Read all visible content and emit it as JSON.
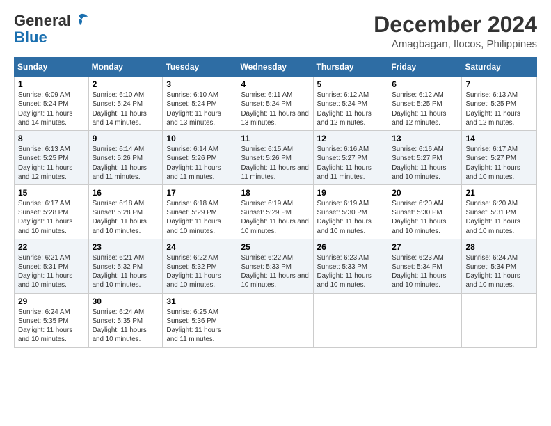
{
  "logo": {
    "general": "General",
    "blue": "Blue"
  },
  "title": {
    "month_year": "December 2024",
    "location": "Amagbagan, Ilocos, Philippines"
  },
  "days_of_week": [
    "Sunday",
    "Monday",
    "Tuesday",
    "Wednesday",
    "Thursday",
    "Friday",
    "Saturday"
  ],
  "weeks": [
    [
      {
        "day": "1",
        "info": "Sunrise: 6:09 AM\nSunset: 5:24 PM\nDaylight: 11 hours and 14 minutes."
      },
      {
        "day": "2",
        "info": "Sunrise: 6:10 AM\nSunset: 5:24 PM\nDaylight: 11 hours and 14 minutes."
      },
      {
        "day": "3",
        "info": "Sunrise: 6:10 AM\nSunset: 5:24 PM\nDaylight: 11 hours and 13 minutes."
      },
      {
        "day": "4",
        "info": "Sunrise: 6:11 AM\nSunset: 5:24 PM\nDaylight: 11 hours and 13 minutes."
      },
      {
        "day": "5",
        "info": "Sunrise: 6:12 AM\nSunset: 5:24 PM\nDaylight: 11 hours and 12 minutes."
      },
      {
        "day": "6",
        "info": "Sunrise: 6:12 AM\nSunset: 5:25 PM\nDaylight: 11 hours and 12 minutes."
      },
      {
        "day": "7",
        "info": "Sunrise: 6:13 AM\nSunset: 5:25 PM\nDaylight: 11 hours and 12 minutes."
      }
    ],
    [
      {
        "day": "8",
        "info": "Sunrise: 6:13 AM\nSunset: 5:25 PM\nDaylight: 11 hours and 12 minutes."
      },
      {
        "day": "9",
        "info": "Sunrise: 6:14 AM\nSunset: 5:26 PM\nDaylight: 11 hours and 11 minutes."
      },
      {
        "day": "10",
        "info": "Sunrise: 6:14 AM\nSunset: 5:26 PM\nDaylight: 11 hours and 11 minutes."
      },
      {
        "day": "11",
        "info": "Sunrise: 6:15 AM\nSunset: 5:26 PM\nDaylight: 11 hours and 11 minutes."
      },
      {
        "day": "12",
        "info": "Sunrise: 6:16 AM\nSunset: 5:27 PM\nDaylight: 11 hours and 11 minutes."
      },
      {
        "day": "13",
        "info": "Sunrise: 6:16 AM\nSunset: 5:27 PM\nDaylight: 11 hours and 10 minutes."
      },
      {
        "day": "14",
        "info": "Sunrise: 6:17 AM\nSunset: 5:27 PM\nDaylight: 11 hours and 10 minutes."
      }
    ],
    [
      {
        "day": "15",
        "info": "Sunrise: 6:17 AM\nSunset: 5:28 PM\nDaylight: 11 hours and 10 minutes."
      },
      {
        "day": "16",
        "info": "Sunrise: 6:18 AM\nSunset: 5:28 PM\nDaylight: 11 hours and 10 minutes."
      },
      {
        "day": "17",
        "info": "Sunrise: 6:18 AM\nSunset: 5:29 PM\nDaylight: 11 hours and 10 minutes."
      },
      {
        "day": "18",
        "info": "Sunrise: 6:19 AM\nSunset: 5:29 PM\nDaylight: 11 hours and 10 minutes."
      },
      {
        "day": "19",
        "info": "Sunrise: 6:19 AM\nSunset: 5:30 PM\nDaylight: 11 hours and 10 minutes."
      },
      {
        "day": "20",
        "info": "Sunrise: 6:20 AM\nSunset: 5:30 PM\nDaylight: 11 hours and 10 minutes."
      },
      {
        "day": "21",
        "info": "Sunrise: 6:20 AM\nSunset: 5:31 PM\nDaylight: 11 hours and 10 minutes."
      }
    ],
    [
      {
        "day": "22",
        "info": "Sunrise: 6:21 AM\nSunset: 5:31 PM\nDaylight: 11 hours and 10 minutes."
      },
      {
        "day": "23",
        "info": "Sunrise: 6:21 AM\nSunset: 5:32 PM\nDaylight: 11 hours and 10 minutes."
      },
      {
        "day": "24",
        "info": "Sunrise: 6:22 AM\nSunset: 5:32 PM\nDaylight: 11 hours and 10 minutes."
      },
      {
        "day": "25",
        "info": "Sunrise: 6:22 AM\nSunset: 5:33 PM\nDaylight: 11 hours and 10 minutes."
      },
      {
        "day": "26",
        "info": "Sunrise: 6:23 AM\nSunset: 5:33 PM\nDaylight: 11 hours and 10 minutes."
      },
      {
        "day": "27",
        "info": "Sunrise: 6:23 AM\nSunset: 5:34 PM\nDaylight: 11 hours and 10 minutes."
      },
      {
        "day": "28",
        "info": "Sunrise: 6:24 AM\nSunset: 5:34 PM\nDaylight: 11 hours and 10 minutes."
      }
    ],
    [
      {
        "day": "29",
        "info": "Sunrise: 6:24 AM\nSunset: 5:35 PM\nDaylight: 11 hours and 10 minutes."
      },
      {
        "day": "30",
        "info": "Sunrise: 6:24 AM\nSunset: 5:35 PM\nDaylight: 11 hours and 10 minutes."
      },
      {
        "day": "31",
        "info": "Sunrise: 6:25 AM\nSunset: 5:36 PM\nDaylight: 11 hours and 11 minutes."
      },
      {
        "day": "",
        "info": ""
      },
      {
        "day": "",
        "info": ""
      },
      {
        "day": "",
        "info": ""
      },
      {
        "day": "",
        "info": ""
      }
    ]
  ]
}
